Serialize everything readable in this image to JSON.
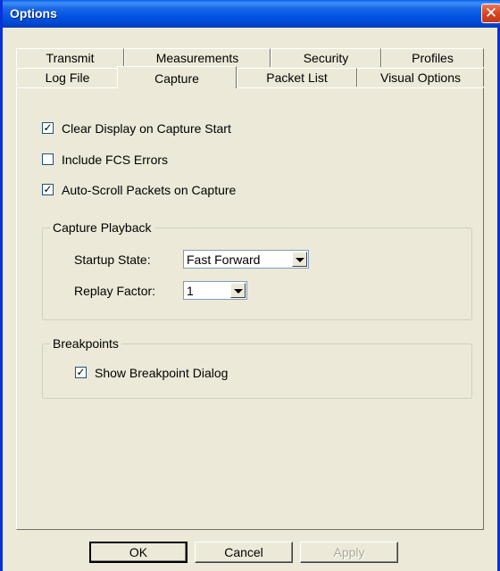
{
  "window": {
    "title": "Options",
    "close_glyph": "✕"
  },
  "tabs_row1": [
    "Transmit",
    "Measurements",
    "Security",
    "Profiles"
  ],
  "tabs_row2": [
    "Log File",
    "Capture",
    "Packet List",
    "Visual Options"
  ],
  "active_tab": "Capture",
  "checkboxes": {
    "clear_display": {
      "label": "Clear Display on Capture Start",
      "checked": true
    },
    "include_fcs": {
      "label": "Include FCS Errors",
      "checked": false
    },
    "auto_scroll": {
      "label": "Auto-Scroll Packets on Capture",
      "checked": true
    }
  },
  "check_glyph": "✓",
  "capture_playback": {
    "title": "Capture Playback",
    "startup_state_label": "Startup State:",
    "startup_state_value": "Fast Forward",
    "replay_factor_label": "Replay Factor:",
    "replay_factor_value": "1"
  },
  "breakpoints": {
    "title": "Breakpoints",
    "show_dialog": {
      "label": "Show Breakpoint Dialog",
      "checked": true
    }
  },
  "buttons": {
    "ok": "OK",
    "cancel": "Cancel",
    "apply": "Apply"
  },
  "colors": {
    "titlebar": "#0054e3",
    "face": "#ece9d8",
    "close": "#d6421f"
  }
}
